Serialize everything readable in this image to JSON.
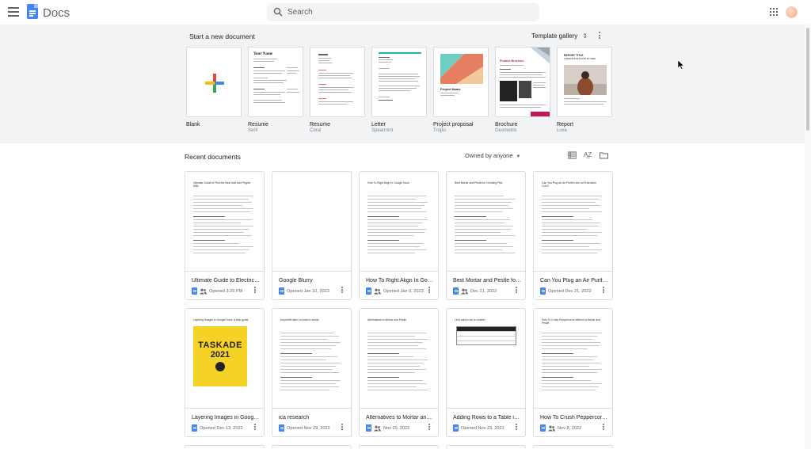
{
  "header": {
    "app_title": "Docs",
    "search_placeholder": "Search",
    "menu_icon": "hamburger-menu-icon",
    "apps_icon": "apps-grid-icon",
    "avatar": "account-avatar"
  },
  "templates": {
    "heading": "Start a new document",
    "gallery_label": "Template gallery",
    "items": [
      {
        "name": "Blank",
        "sub": ""
      },
      {
        "name": "Resume",
        "sub": "Serif"
      },
      {
        "name": "Resume",
        "sub": "Coral"
      },
      {
        "name": "Letter",
        "sub": "Spearmint"
      },
      {
        "name": "Project proposal",
        "sub": "Tropic"
      },
      {
        "name": "Brochure",
        "sub": "Geometric"
      },
      {
        "name": "Report",
        "sub": "Luxe"
      }
    ],
    "preview_texts": {
      "resume_serif_name": "Your Name",
      "project_name": "Project Name",
      "brochure_title": "Product Brochure",
      "report_line1": "REPORT TITLE",
      "report_line2": "LOREM IPSUM DOLOR SIT AMET"
    }
  },
  "recent": {
    "heading": "Recent documents",
    "owner_filter": "Owned by anyone",
    "documents": [
      {
        "title": "Ultimate Guide to Electric Stoves and Pepper Mills",
        "date": "Opened 3:25 PM",
        "shared": true
      },
      {
        "title": "Google Blurry",
        "date": "Opened Jan 10, 2023",
        "shared": false
      },
      {
        "title": "How To Right Align In Google Docs",
        "date": "Opened Jan 9, 2023",
        "shared": true
      },
      {
        "title": "Best Mortar and Pestle for Grinding Pills",
        "date": "Dec 21, 2022",
        "shared": true
      },
      {
        "title": "Can You Plug an Air Purifier into an Extension Cord",
        "date": "Opened Dec 21, 2022",
        "shared": false
      },
      {
        "title": "Layering Images in Google Docs",
        "date": "Opened Dec 13, 2022",
        "shared": false
      },
      {
        "title": "ica research",
        "date": "Opened Nov 29, 2022",
        "shared": false
      },
      {
        "title": "Alternatives to Mortar and Pestle",
        "date": "Nov 29, 2022",
        "shared": true
      },
      {
        "title": "Adding Rows to a Table in Google Docs",
        "date": "Opened Nov 23, 2022",
        "shared": false
      },
      {
        "title": "How To Crush Peppercorns Without a Grinder",
        "date": "Nov 8, 2022",
        "shared": true
      }
    ],
    "thumb_headings": [
      "Ultimate Guide to Find the Best Salt and Pepper Mills",
      "",
      "How To Right Align In Google Docs",
      "Best Mortar and Pestle for Grinding Pills",
      "Can You Plug an Air Purifier into an Extension Cord?",
      "Layering Images in Google Docs: a step guide",
      "ica profile tabs on search results",
      "Alternatives to Mortar and Pestle",
      "Let's add a row to a table!",
      "How To Crush Peppercorns Without a Mortar and Pestle"
    ],
    "taskade_text": "TASKADE",
    "taskade_year": "2021"
  }
}
